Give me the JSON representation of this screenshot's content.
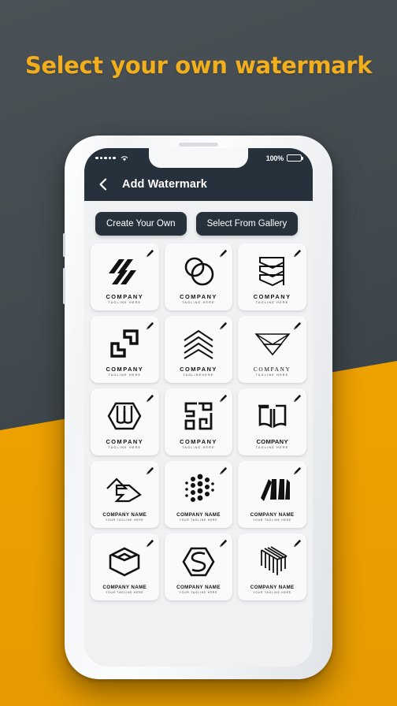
{
  "headline": "Select your own watermark",
  "theme": {
    "accent_yellow": "#f3ae1c",
    "band_yellow": "#eea200",
    "dark_bg": "#434b50",
    "app_dark": "#26313c",
    "card_bg": "#fafafa"
  },
  "phone": {
    "status_bar": {
      "signal_dots": 5,
      "wifi_icon": "wifi-icon",
      "battery_percent": "100%",
      "battery_icon": "battery-icon"
    },
    "appbar": {
      "back_icon": "chevron-left-icon",
      "title": "Add Watermark"
    },
    "tabs": [
      {
        "label": "Create Your Own",
        "name": "tab-create-your-own"
      },
      {
        "label": "Select From Gallery",
        "name": "tab-select-from-gallery"
      }
    ],
    "gallery": {
      "edit_icon": "pencil-icon",
      "items": [
        {
          "art": "diagonal-slashes-logo",
          "name": "COMPANY",
          "tagline": "TAGLINE HERE",
          "style": "bold"
        },
        {
          "art": "overlapping-circles-logo",
          "name": "COMPANY",
          "tagline": "TAGLINE HERE",
          "style": "bold"
        },
        {
          "art": "chevron-stack-logo",
          "name": "COMPANY",
          "tagline": "TAGLINE HERE",
          "style": "bold"
        },
        {
          "art": "bracket-squares-logo",
          "name": "COMPANY",
          "tagline": "TAGLINE HERE",
          "style": "bold"
        },
        {
          "art": "arrow-chevrons-logo",
          "name": "COMPANY",
          "tagline": "TAGLINEHERE",
          "style": "bold"
        },
        {
          "art": "triangle-mesh-logo",
          "name": "COMPANY",
          "tagline": "TAGLINE HERE",
          "style": "serif"
        },
        {
          "art": "hexagon-w-monogram-logo",
          "name": "COMPANY",
          "tagline": "TAGLINE HERE",
          "style": "bold"
        },
        {
          "art": "sb-monogram-logo",
          "name": "COMPANY",
          "tagline": "TAGLINE HERE",
          "style": "bold"
        },
        {
          "art": "open-book-logo",
          "name": "COMPANY",
          "tagline": "TAGLINE HERE",
          "style": "narrow"
        },
        {
          "art": "arrow-outline-logo",
          "name": "COMPANY NAME",
          "tagline": "YOUR TAGLINE HERE",
          "style": "small"
        },
        {
          "art": "dot-hexagon-logo",
          "name": "COMPANY NAME",
          "tagline": "YOUR TAGLINE HERE",
          "style": "small"
        },
        {
          "art": "slanted-bars-logo",
          "name": "COMPANY NAME",
          "tagline": "YOUR TAGLINE HERE",
          "style": "small"
        },
        {
          "art": "cube-box-logo",
          "name": "COMPANY NAME",
          "tagline": "YOUR TAGLINE HERE",
          "style": "small"
        },
        {
          "art": "hexagon-s-logo",
          "name": "COMPANY NAME",
          "tagline": "YOUR TAGLINE HERE",
          "style": "small"
        },
        {
          "art": "isometric-lines-logo",
          "name": "COMPANY NAME",
          "tagline": "YOUR TAGLINE HERE",
          "style": "small"
        }
      ]
    }
  }
}
